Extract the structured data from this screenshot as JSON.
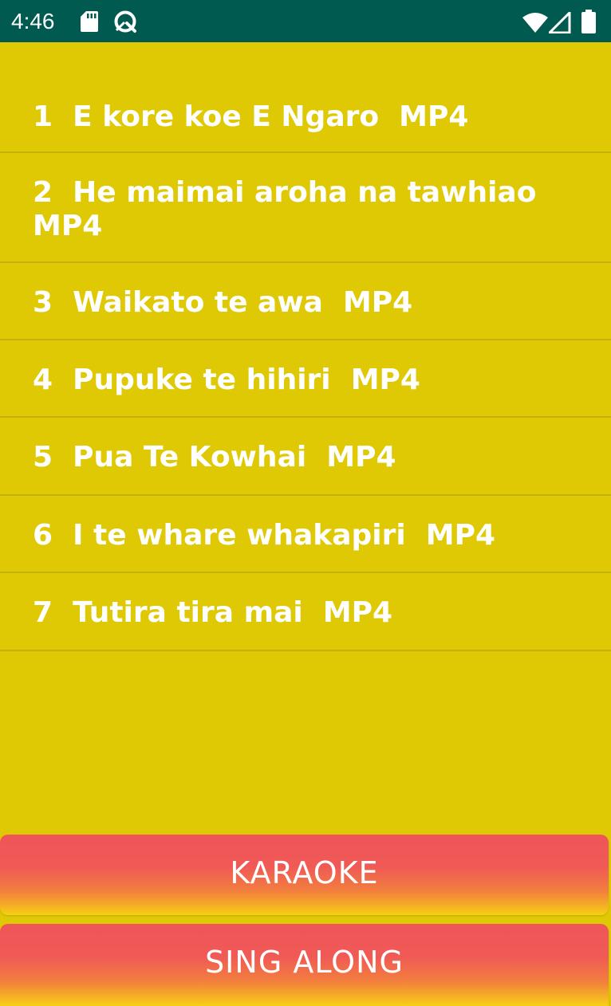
{
  "status_bar": {
    "time": "4:46",
    "icons": [
      "sd-card-icon",
      "vpn-key-icon",
      "wifi-icon",
      "signal-icon",
      "battery-icon"
    ],
    "background": "#005A50"
  },
  "songs": [
    {
      "label": "1  E kore koe E Ngaro  MP4"
    },
    {
      "label": "2  He maimai aroha na tawhiao MP4"
    },
    {
      "label": "3  Waikato te awa  MP4"
    },
    {
      "label": "4  Pupuke te hihiri  MP4"
    },
    {
      "label": "5  Pua Te Kowhai  MP4"
    },
    {
      "label": "6  I te whare whakapiri  MP4"
    },
    {
      "label": "7  Tutira tira mai  MP4"
    }
  ],
  "buttons": {
    "karaoke": "KARAOKE",
    "sing_along": "SING ALONG"
  },
  "colors": {
    "background": "#DFC904",
    "text": "#FFFFFF",
    "button_top": "#F05559",
    "button_bottom": "#F7D016"
  }
}
